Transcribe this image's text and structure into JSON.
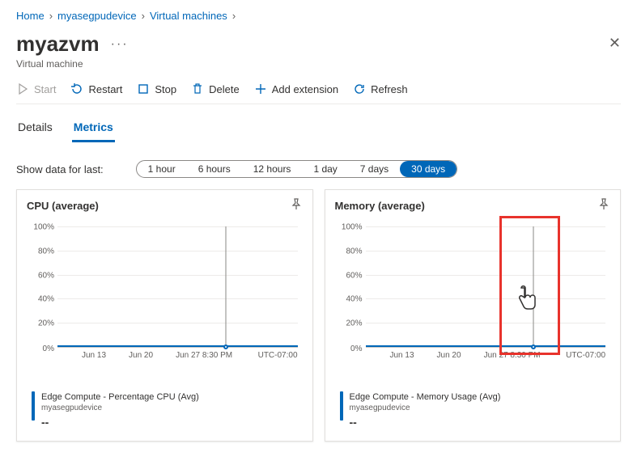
{
  "breadcrumb": {
    "home": "Home",
    "device": "myasegpudevice",
    "section": "Virtual machines"
  },
  "header": {
    "title": "myazvm",
    "subtitle": "Virtual machine"
  },
  "toolbar": {
    "start": "Start",
    "restart": "Restart",
    "stop": "Stop",
    "delete": "Delete",
    "add_extension": "Add extension",
    "refresh": "Refresh"
  },
  "tabs": {
    "details": "Details",
    "metrics": "Metrics"
  },
  "filters": {
    "label": "Show data for last:",
    "options": [
      "1 hour",
      "6 hours",
      "12 hours",
      "1 day",
      "7 days",
      "30 days"
    ],
    "active": "30 days"
  },
  "cards": {
    "cpu": {
      "title": "CPU (average)",
      "legend_title": "Edge Compute - Percentage CPU (Avg)",
      "legend_sub": "myasegpudevice",
      "legend_value": "--"
    },
    "memory": {
      "title": "Memory (average)",
      "legend_title": "Edge Compute - Memory Usage (Avg)",
      "legend_sub": "myasegpudevice",
      "legend_value": "--"
    }
  },
  "chart_data": [
    {
      "type": "line",
      "title": "CPU (average)",
      "ylabel": "",
      "ylim": [
        0,
        100
      ],
      "y_ticks": [
        "100%",
        "80%",
        "60%",
        "40%",
        "20%",
        "0%"
      ],
      "x_ticks": [
        "Jun 13",
        "Jun 20",
        "Jun 27 8:30 PM"
      ],
      "tz": "UTC-07:00",
      "series": [
        {
          "name": "Edge Compute - Percentage CPU (Avg)",
          "values": [
            0,
            0,
            0,
            0,
            0,
            0
          ]
        }
      ],
      "hover_x": "Jun 27 8:30 PM"
    },
    {
      "type": "line",
      "title": "Memory (average)",
      "ylabel": "",
      "ylim": [
        0,
        100
      ],
      "y_ticks": [
        "100%",
        "80%",
        "60%",
        "40%",
        "20%",
        "0%"
      ],
      "x_ticks": [
        "Jun 13",
        "Jun 20",
        "Jun 27 8:30 PM"
      ],
      "tz": "UTC-07:00",
      "series": [
        {
          "name": "Edge Compute - Memory Usage (Avg)",
          "values": [
            0,
            0,
            0,
            0,
            0,
            0
          ]
        }
      ],
      "hover_x": "Jun 27 8:30 PM"
    }
  ]
}
